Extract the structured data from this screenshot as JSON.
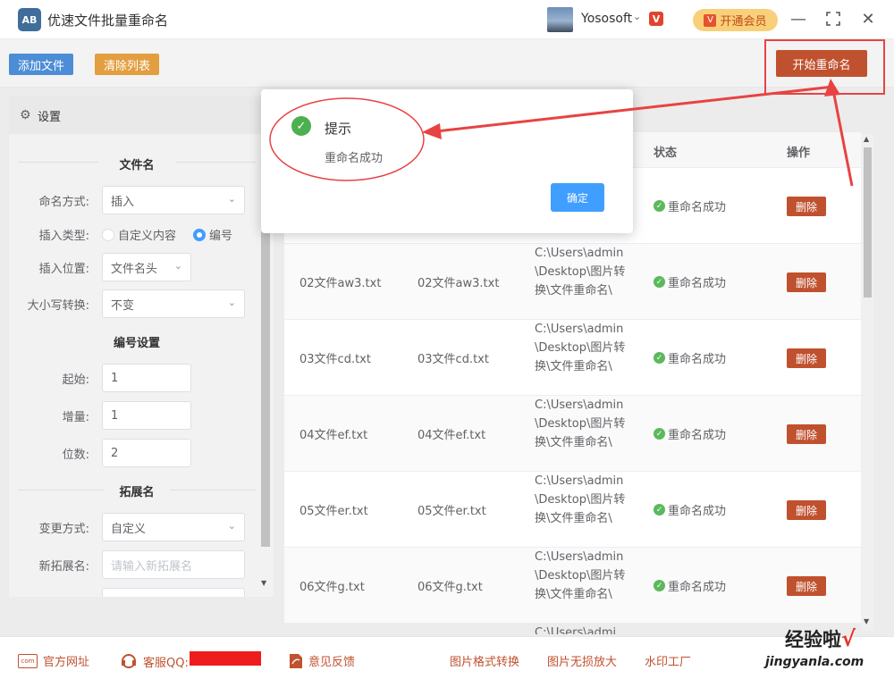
{
  "app": {
    "title": "优速文件批量重命名",
    "logo_text": "AB",
    "user_name": "Yososoft",
    "vip_label": "开通会员"
  },
  "toolbar": {
    "add_file": "添加文件",
    "clear_list": "清除列表",
    "start_rename": "开始重命名"
  },
  "settings": {
    "header": "设置",
    "filename_section": "文件名",
    "naming_method_label": "命名方式:",
    "naming_method_value": "插入",
    "insert_type_label": "插入类型:",
    "insert_type_options": [
      "自定义内容",
      "编号"
    ],
    "insert_type_selected": "编号",
    "insert_position_label": "插入位置:",
    "insert_position_value": "文件名头",
    "case_label": "大小写转换:",
    "case_value": "不变",
    "numbering_section": "编号设置",
    "start_label": "起始:",
    "start_value": "1",
    "step_label": "增量:",
    "step_value": "1",
    "digits_label": "位数:",
    "digits_value": "2",
    "extension_section": "拓展名",
    "change_method_label": "变更方式:",
    "change_method_value": "自定义",
    "new_ext_label": "新拓展名:",
    "new_ext_placeholder": "请输入新拓展名"
  },
  "table": {
    "columns": {
      "status": "状态",
      "action": "操作"
    },
    "rows": [
      {
        "original": "",
        "new": "",
        "path": "",
        "status": "重命名成功",
        "action": "删除"
      },
      {
        "original": "02文件aw3.txt",
        "new": "02文件aw3.txt",
        "path": "C:\\Users\\admin\\Desktop\\图片转换\\文件重命名\\",
        "status": "重命名成功",
        "action": "删除"
      },
      {
        "original": "03文件cd.txt",
        "new": "03文件cd.txt",
        "path": "C:\\Users\\admin\\Desktop\\图片转换\\文件重命名\\",
        "status": "重命名成功",
        "action": "删除"
      },
      {
        "original": "04文件ef.txt",
        "new": "04文件ef.txt",
        "path": "C:\\Users\\admin\\Desktop\\图片转换\\文件重命名\\",
        "status": "重命名成功",
        "action": "删除"
      },
      {
        "original": "05文件er.txt",
        "new": "05文件er.txt",
        "path": "C:\\Users\\admin\\Desktop\\图片转换\\文件重命名\\",
        "status": "重命名成功",
        "action": "删除"
      },
      {
        "original": "06文件g.txt",
        "new": "06文件g.txt",
        "path": "C:\\Users\\admin\\Desktop\\图片转换\\文件重命名\\",
        "status": "重命名成功",
        "action": "删除"
      }
    ],
    "partial_row_path": "C:\\Users\\admi"
  },
  "dialog": {
    "title": "提示",
    "message": "重命名成功",
    "ok": "确定"
  },
  "footer": {
    "website": "官方网址",
    "website_icon_text": "com",
    "support": "客服QQ:",
    "feedback": "意见反馈",
    "link1": "图片格式转换",
    "link2": "图片无损放大",
    "link3": "水印工厂"
  },
  "watermark": {
    "text": "经验啦",
    "check": "√",
    "url": "jingyanla.com"
  },
  "colors": {
    "accent_blue": "#409eff",
    "danger_orange": "#c0512e",
    "success_green": "#4caf50",
    "annotation_red": "#e84343"
  }
}
